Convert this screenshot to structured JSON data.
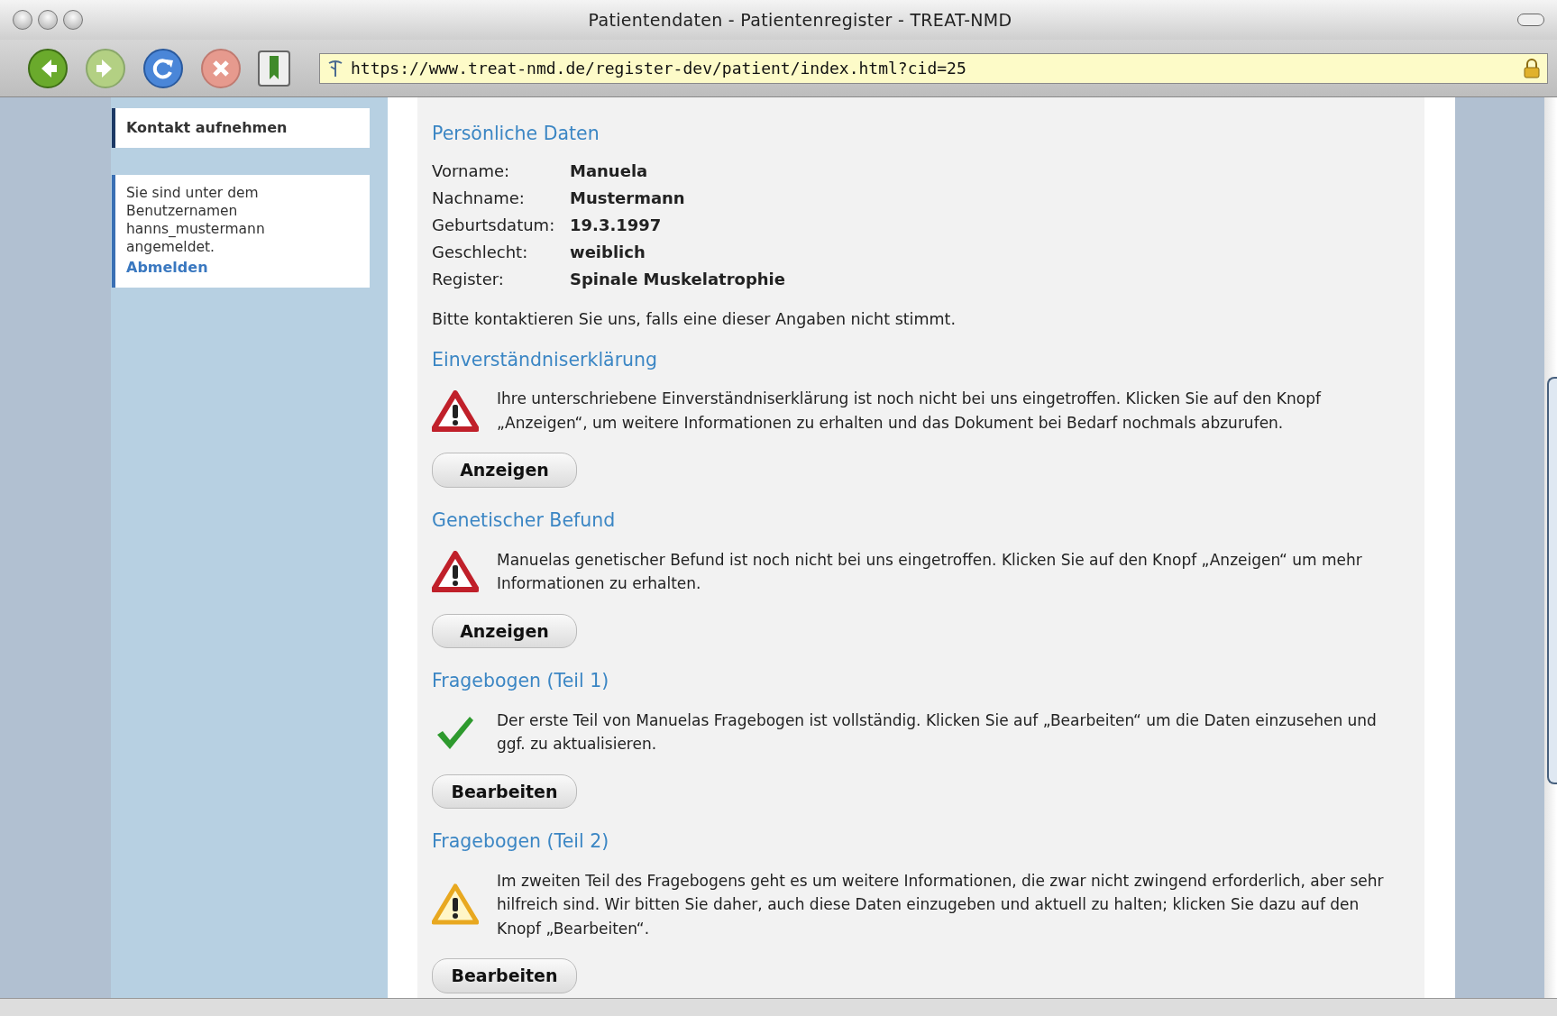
{
  "window": {
    "title": "Patientendaten - Patientenregister - TREAT-NMD"
  },
  "address_bar": {
    "url": "https://www.treat-nmd.de/register-dev/patient/index.html?cid=25"
  },
  "sidebar": {
    "items": [
      {
        "label": "Kontakt aufnehmen"
      }
    ],
    "login_box": {
      "text": "Sie sind unter dem Benutzernamen hanns_mustermann angemeldet.",
      "link": "Abmelden"
    }
  },
  "personal": {
    "heading": "Persönliche Daten",
    "fields": [
      {
        "label": "Vorname:",
        "value": "Manuela"
      },
      {
        "label": "Nachname:",
        "value": "Mustermann"
      },
      {
        "label": "Geburtsdatum:",
        "value": "19.3.1997"
      },
      {
        "label": "Geschlecht:",
        "value": "weiblich"
      },
      {
        "label": "Register:",
        "value": "Spinale Muskelatrophie"
      }
    ],
    "note": "Bitte kontaktieren Sie uns, falls eine dieser Angaben nicht stimmt."
  },
  "sections": [
    {
      "heading": "Einverständniserklärung",
      "kind": "error",
      "text": "Ihre unterschriebene Einverständniserklärung ist noch nicht bei uns eingetroffen. Klicken Sie auf den Knopf „Anzeigen“, um weitere Informationen zu erhalten und das Dokument bei Bedarf nochmals abzurufen.",
      "button": "Anzeigen"
    },
    {
      "heading": "Genetischer Befund",
      "kind": "error",
      "text": "Manuelas genetischer Befund ist noch nicht bei uns eingetroffen. Klicken Sie auf den Knopf „Anzeigen“ um mehr Informationen zu erhalten.",
      "button": "Anzeigen"
    },
    {
      "heading": "Fragebogen (Teil 1)",
      "kind": "ok",
      "text": "Der erste Teil von Manuelas Fragebogen ist vollständig. Klicken Sie auf „Bearbeiten“ um die Daten einzusehen und ggf. zu aktualisieren.",
      "button": "Bearbeiten"
    },
    {
      "heading": "Fragebogen (Teil 2)",
      "kind": "warning",
      "text": "Im zweiten Teil des Fragebogens geht es um weitere Informationen, die zwar nicht zwingend erforderlich, aber sehr hilfreich sind. Wir bitten Sie daher, auch diese Daten einzugeben und aktuell zu halten; klicken Sie dazu auf den Knopf „Bearbeiten“.",
      "button": "Bearbeiten"
    }
  ]
}
